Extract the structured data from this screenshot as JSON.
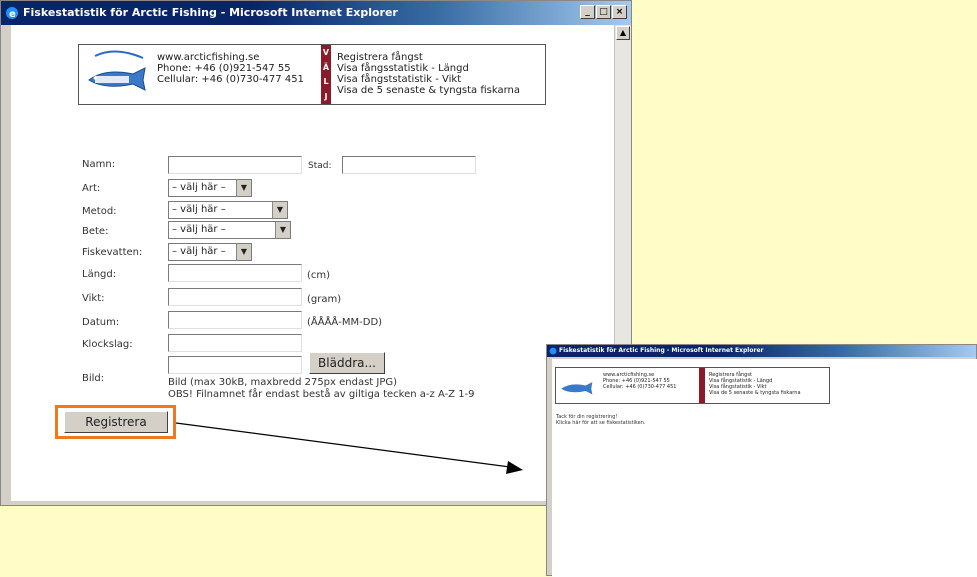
{
  "colors": {
    "background": "#fffcc8",
    "highlight": "#f07820",
    "vali_bar": "#8b1a2b",
    "titlebar": "#0a246a"
  },
  "main_window": {
    "title": "Fiskestatistik för Arctic Fishing - Microsoft Internet Explorer",
    "controls": [
      "_",
      "□",
      "×"
    ],
    "banner": {
      "logo_icon": "fish-logo-icon",
      "logo_text": "arcticfishing.se",
      "contact": [
        "www.arcticfishing.se",
        "Phone: +46 (0)921-547 55",
        "Cellular: +46 (0)730-477 451"
      ],
      "vali_letters": [
        "V",
        "Ä",
        "L",
        "J"
      ],
      "menu": [
        "Registrera fångst",
        "Visa fångsstatistik - Längd",
        "Visa fångststatistik - Vikt",
        "Visa de 5 senaste & tyngsta fiskarna"
      ]
    },
    "form": {
      "namn_label": "Namn:",
      "stad_label": "Stad:",
      "art_label": "Art:",
      "art_value": "– välj här –",
      "metod_label": "Metod:",
      "metod_value": "– välj här –",
      "bete_label": "Bete:",
      "bete_value": "– välj här –",
      "fiskevatten_label": "Fiskevatten:",
      "fiskevatten_value": "– välj här –",
      "langd_label": "Längd:",
      "langd_unit": "(cm)",
      "vikt_label": "Vikt:",
      "vikt_unit": "(gram)",
      "datum_label": "Datum:",
      "datum_unit": "(ÅÅÅÅ-MM-DD)",
      "klockslag_label": "Klockslag:",
      "bild_label": "Bild:",
      "browse_button": "Bläddra...",
      "bild_note1": "Bild (max 30kB, maxbredd 275px endast JPG)",
      "bild_note2": "OBS! Filnamnet får endast bestå av giltiga tecken a-z A-Z 1-9",
      "submit_button": "Registrera"
    }
  },
  "second_window": {
    "title": "Fiskestatistik för Arctic Fishing - Microsoft Internet Explorer",
    "contact": [
      "www.arcticfishing.se",
      "Phone: +46 (0)921-547 55",
      "Cellular: +46 (0)730-477 451"
    ],
    "menu": [
      "Registrera fångst",
      "Visa fångstatistik - Längd",
      "Visa fångstatistik - Vikt",
      "Visa de 5 senaste & tyngsta fiskarna"
    ],
    "message1": "Tack för din registrering!",
    "message2": "Klicka här för att se fiskestatistiken."
  }
}
